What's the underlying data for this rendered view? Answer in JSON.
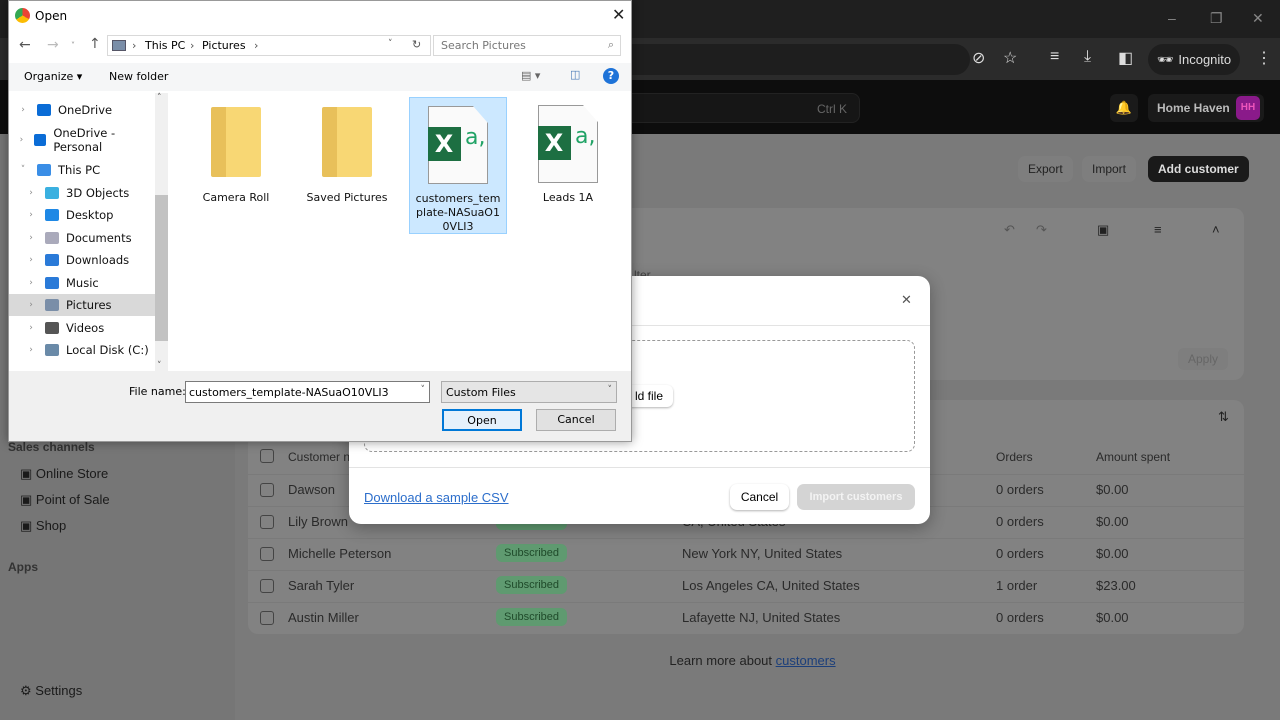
{
  "browser": {
    "incognito_label": "Incognito",
    "window_controls": [
      "minimize-icon",
      "restore-icon",
      "close-icon"
    ]
  },
  "shop_header": {
    "search_shortcut": "Ctrl K",
    "store_name": "Home Haven",
    "avatar_initials": "HH"
  },
  "page_actions": {
    "export": "Export",
    "import": "Import",
    "add_customer": "Add customer"
  },
  "filter_panel": {
    "apply": "Apply",
    "partial_text": "lter"
  },
  "sidebar": {
    "sales_channels": "Sales channels",
    "items": [
      "Online Store",
      "Point of Sale",
      "Shop"
    ],
    "apps": "Apps",
    "settings": "Settings"
  },
  "table": {
    "headers": [
      "Customer name",
      "Orders",
      "Amount spent"
    ],
    "rows": [
      {
        "name": "Dawson",
        "subscription": "",
        "location": "",
        "orders": "0 orders",
        "amount": "$0.00"
      },
      {
        "name": "Lily Brown",
        "subscription": "Subscribed",
        "location": "CA, United States",
        "orders": "0 orders",
        "amount": "$0.00"
      },
      {
        "name": "Michelle Peterson",
        "subscription": "Subscribed",
        "location": "New York NY, United States",
        "orders": "0 orders",
        "amount": "$0.00"
      },
      {
        "name": "Sarah Tyler",
        "subscription": "Subscribed",
        "location": "Los Angeles CA, United States",
        "orders": "1 order",
        "amount": "$23.00"
      },
      {
        "name": "Austin Miller",
        "subscription": "Subscribed",
        "location": "Lafayette NJ, United States",
        "orders": "0 orders",
        "amount": "$0.00"
      }
    ],
    "learn_more_prefix": "Learn more about ",
    "learn_more_link": "customers"
  },
  "import_modal": {
    "add_file_partial": "ld file",
    "download_sample": "Download a sample CSV",
    "cancel": "Cancel",
    "import_button": "Import customers"
  },
  "open_dialog": {
    "title": "Open",
    "breadcrumb": [
      "This PC",
      "Pictures"
    ],
    "search_placeholder": "Search Pictures",
    "organize": "Organize",
    "new_folder": "New folder",
    "nav": [
      {
        "label": "OneDrive",
        "icon": "cloud-icon"
      },
      {
        "label": "OneDrive - Personal",
        "icon": "cloud-icon"
      },
      {
        "label": "This PC",
        "icon": "computer-icon"
      },
      {
        "label": "3D Objects",
        "icon": "cube-icon"
      },
      {
        "label": "Desktop",
        "icon": "desktop-icon"
      },
      {
        "label": "Documents",
        "icon": "document-icon"
      },
      {
        "label": "Downloads",
        "icon": "download-icon"
      },
      {
        "label": "Music",
        "icon": "music-icon"
      },
      {
        "label": "Pictures",
        "icon": "pictures-icon",
        "selected": true
      },
      {
        "label": "Videos",
        "icon": "video-icon"
      },
      {
        "label": "Local Disk (C:)",
        "icon": "disk-icon"
      }
    ],
    "files": [
      {
        "name": "Camera Roll",
        "type": "folder"
      },
      {
        "name": "Saved Pictures",
        "type": "folder"
      },
      {
        "name": "customers_template-NASuaO10VLI3",
        "type": "csv",
        "selected": true
      },
      {
        "name": "Leads 1A",
        "type": "csv"
      }
    ],
    "file_name_label": "File name:",
    "file_name_value": "customers_template-NASuaO10VLI3",
    "file_type": "Custom Files",
    "open": "Open",
    "cancel": "Cancel"
  },
  "colors": {
    "excel_green": "#1d6f42",
    "selection": "#cce8ff",
    "link": "#2c6ecb",
    "badge": "#5f9a70"
  }
}
